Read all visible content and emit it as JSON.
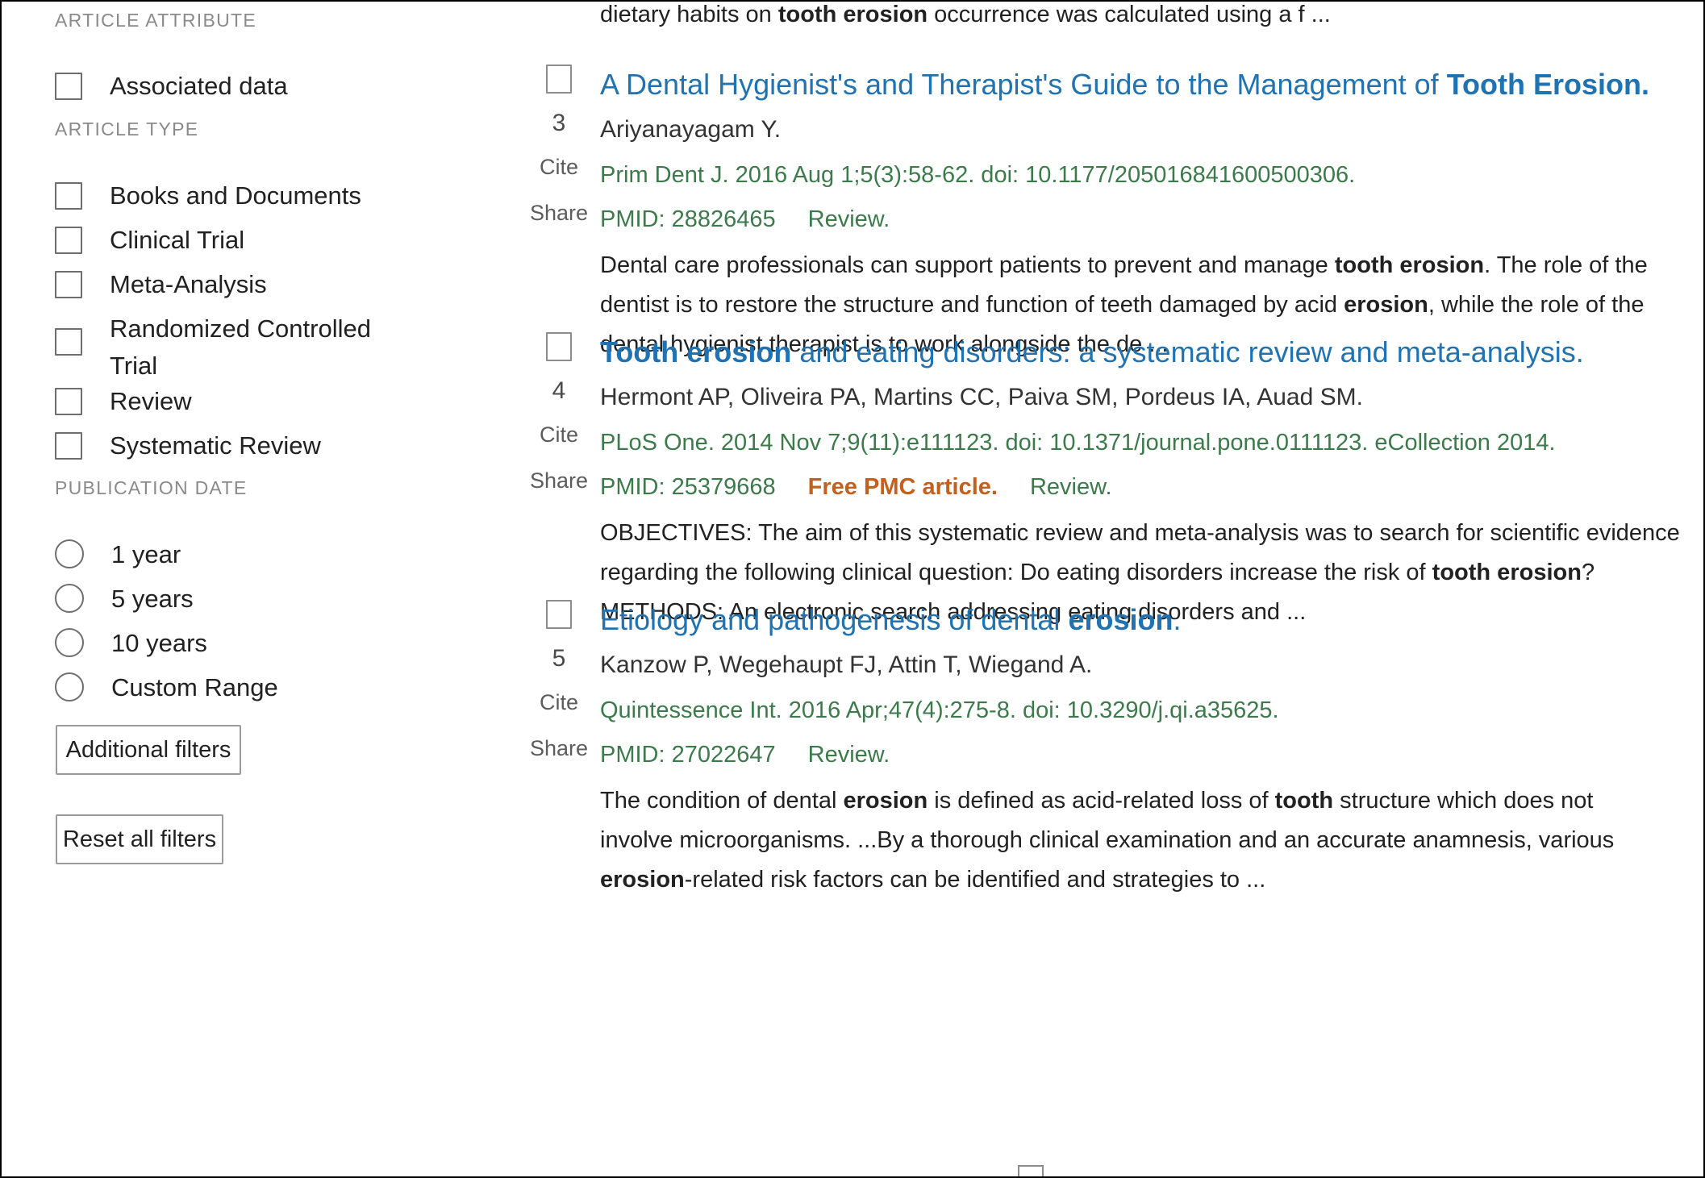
{
  "sidebar": {
    "groups": [
      {
        "title": "ARTICLE ATTRIBUTE",
        "control": "checkbox",
        "options": [
          {
            "label": "Associated data",
            "checked": false
          }
        ]
      },
      {
        "title": "ARTICLE TYPE",
        "control": "checkbox",
        "options": [
          {
            "label": "Books and Documents",
            "checked": false
          },
          {
            "label": "Clinical Trial",
            "checked": false
          },
          {
            "label": "Meta-Analysis",
            "checked": false
          },
          {
            "label": "Randomized Controlled Trial",
            "checked": false
          },
          {
            "label": "Review",
            "checked": false
          },
          {
            "label": "Systematic Review",
            "checked": false
          }
        ]
      },
      {
        "title": "PUBLICATION DATE",
        "control": "radio",
        "options": [
          {
            "label": "1 year",
            "checked": false
          },
          {
            "label": "5 years",
            "checked": false
          },
          {
            "label": "10 years",
            "checked": false
          },
          {
            "label": "Custom Range",
            "checked": false
          }
        ]
      }
    ],
    "additional_filters_label": "Additional filters",
    "reset_all_filters_label": "Reset all filters"
  },
  "results_pane": {
    "previous_result_tail": {
      "pre": "dietary habits on ",
      "bold": "tooth erosion",
      "post": " occurrence was calculated using a f ..."
    },
    "actions": {
      "cite_label": "Cite",
      "share_label": "Share"
    },
    "results": [
      {
        "index": "3",
        "title_parts": [
          {
            "text": "A Dental Hygienist's and Therapist's Guide to the Management of ",
            "bold": false
          },
          {
            "text": "Tooth Erosion.",
            "bold": true
          }
        ],
        "authors": "Ariyanayagam Y.",
        "journal": "Prim Dent J. 2016 Aug 1;5(3):58-62. doi: 10.1177/205016841600500306.",
        "pmid": "PMID: 28826465",
        "free_pmc": "",
        "pub_type": "Review.",
        "snippet_parts": [
          {
            "text": "Dental care professionals can support patients to prevent and manage ",
            "bold": false
          },
          {
            "text": "tooth erosion",
            "bold": true
          },
          {
            "text": ". The role of the dentist is to restore the structure and function of teeth damaged by acid ",
            "bold": false
          },
          {
            "text": "erosion",
            "bold": true
          },
          {
            "text": ", while the role of the dental hygienist therapist is to work alongside the de ...",
            "bold": false
          }
        ]
      },
      {
        "index": "4",
        "title_parts": [
          {
            "text": "Tooth erosion",
            "bold": true
          },
          {
            "text": " and eating disorders: a systematic review and meta-analysis.",
            "bold": false
          }
        ],
        "authors": "Hermont AP, Oliveira PA, Martins CC, Paiva SM, Pordeus IA, Auad SM.",
        "journal": "PLoS One. 2014 Nov 7;9(11):e111123. doi: 10.1371/journal.pone.0111123. eCollection 2014.",
        "pmid": "PMID: 25379668",
        "free_pmc": "Free PMC article.",
        "pub_type": "Review.",
        "snippet_parts": [
          {
            "text": "OBJECTIVES: The aim of this systematic review and meta-analysis was to search for scientific evidence regarding the following clinical question: Do eating disorders increase the risk of ",
            "bold": false
          },
          {
            "text": "tooth erosion",
            "bold": true
          },
          {
            "text": "? METHODS: An electronic search addressing eating disorders and ...",
            "bold": false
          }
        ]
      },
      {
        "index": "5",
        "title_parts": [
          {
            "text": "Etiology and pathogenesis of dental ",
            "bold": false
          },
          {
            "text": "erosion",
            "bold": true
          },
          {
            "text": ".",
            "bold": false
          }
        ],
        "authors": "Kanzow P, Wegehaupt FJ, Attin T, Wiegand A.",
        "journal": "Quintessence Int. 2016 Apr;47(4):275-8. doi: 10.3290/j.qi.a35625.",
        "pmid": "PMID: 27022647",
        "free_pmc": "",
        "pub_type": "Review.",
        "snippet_parts": [
          {
            "text": "The condition of dental ",
            "bold": false
          },
          {
            "text": "erosion",
            "bold": true
          },
          {
            "text": " is defined as acid-related loss of ",
            "bold": false
          },
          {
            "text": "tooth",
            "bold": true
          },
          {
            "text": " structure which does not involve microorganisms. ...By a thorough clinical examination and an accurate anamnesis, various ",
            "bold": false
          },
          {
            "text": "erosion",
            "bold": true
          },
          {
            "text": "-related risk factors can be identified and strategies to ...",
            "bold": false
          }
        ]
      }
    ]
  },
  "colors": {
    "link_blue": "#2072b0",
    "journal_green": "#3d7a4b",
    "free_pmc_orange": "#c4601d",
    "muted_gray": "#8a8a8a",
    "text": "#212121"
  }
}
